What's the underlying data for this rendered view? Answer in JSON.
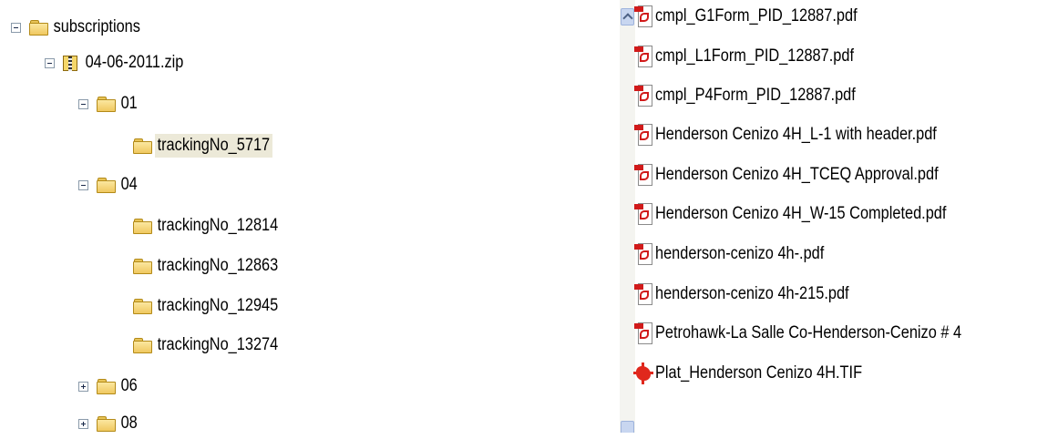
{
  "tree": {
    "root": {
      "label": "subscriptions",
      "toggle": "minus"
    },
    "zip": {
      "label": "04-06-2011.zip",
      "toggle": "minus"
    },
    "folder_01": {
      "label": "01",
      "toggle": "minus"
    },
    "folder_01_children": [
      {
        "label": "trackingNo_5717",
        "selected": true
      }
    ],
    "folder_04": {
      "label": "04",
      "toggle": "minus"
    },
    "folder_04_children": [
      {
        "label": "trackingNo_12814"
      },
      {
        "label": "trackingNo_12863"
      },
      {
        "label": "trackingNo_12945"
      },
      {
        "label": "trackingNo_13274"
      }
    ],
    "folder_06": {
      "label": "06",
      "toggle": "plus"
    },
    "folder_08": {
      "label": "08",
      "toggle": "plus"
    }
  },
  "files": [
    {
      "name": "cmpl_G1Form_PID_12887.pdf",
      "icon": "pdf-icon"
    },
    {
      "name": "cmpl_L1Form_PID_12887.pdf",
      "icon": "pdf-icon"
    },
    {
      "name": "cmpl_P4Form_PID_12887.pdf",
      "icon": "pdf-icon"
    },
    {
      "name": "Henderson Cenizo 4H_L-1 with header.pdf",
      "icon": "pdf-icon"
    },
    {
      "name": "Henderson Cenizo 4H_TCEQ Approval.pdf",
      "icon": "pdf-icon"
    },
    {
      "name": "Henderson Cenizo 4H_W-15 Completed.pdf",
      "icon": "pdf-icon"
    },
    {
      "name": "henderson-cenizo 4h-.pdf",
      "icon": "pdf-icon"
    },
    {
      "name": "henderson-cenizo 4h-215.pdf",
      "icon": "pdf-icon"
    },
    {
      "name": "Petrohawk-La Salle Co-Henderson-Cenizo # 4",
      "icon": "pdf-icon"
    },
    {
      "name": "Plat_Henderson Cenizo 4H.TIF",
      "icon": "tif-icon"
    }
  ],
  "colors": {
    "selection": "#ece9d8",
    "folder": "#f0c860",
    "pdf_red": "#d11a1a",
    "tif_red": "#e0281d"
  }
}
